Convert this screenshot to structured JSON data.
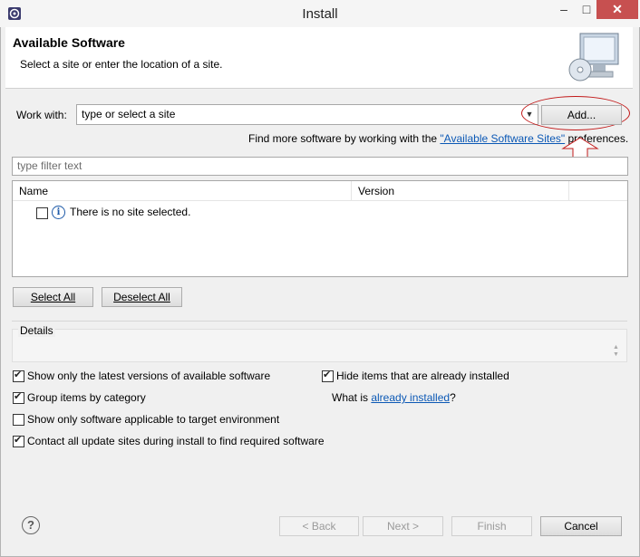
{
  "window": {
    "title": "Install",
    "icon": "eclipse-icon"
  },
  "banner": {
    "title": "Available Software",
    "description": "Select a site or enter the location of a site.",
    "icon": "monitor-cd-icon"
  },
  "work_with": {
    "label": "Work with:",
    "value": "type or select a site",
    "add_button": "Add...",
    "find_more_prefix": "Find more software by working with the ",
    "find_more_link": "\"Available Software Sites\"",
    "find_more_suffix": " preferences."
  },
  "filter": {
    "placeholder": "type filter text"
  },
  "table": {
    "columns": [
      "Name",
      "Version"
    ],
    "rows": [
      {
        "checked": false,
        "icon": "info-icon",
        "name": "There is no site selected."
      }
    ]
  },
  "buttons": {
    "select_all": "Select All",
    "deselect_all": "Deselect All"
  },
  "details": {
    "label": "Details"
  },
  "options": {
    "show_latest": {
      "label": "Show only the latest versions of available software",
      "checked": true
    },
    "group_category": {
      "label": "Group items by category",
      "checked": true
    },
    "target_env": {
      "label": "Show only software applicable to target environment",
      "checked": false
    },
    "contact_sites": {
      "label": "Contact all update sites during install to find required software",
      "checked": true
    },
    "hide_installed": {
      "label": "Hide items that are already installed",
      "checked": true
    },
    "what_is_prefix": "What is ",
    "what_is_link": "already installed",
    "what_is_suffix": "?"
  },
  "footer": {
    "back": "< Back",
    "next": "Next >",
    "finish": "Finish",
    "cancel": "Cancel"
  },
  "colors": {
    "link": "#0b58b5",
    "annotation": "#c21a1a",
    "close_button": "#c75050"
  }
}
